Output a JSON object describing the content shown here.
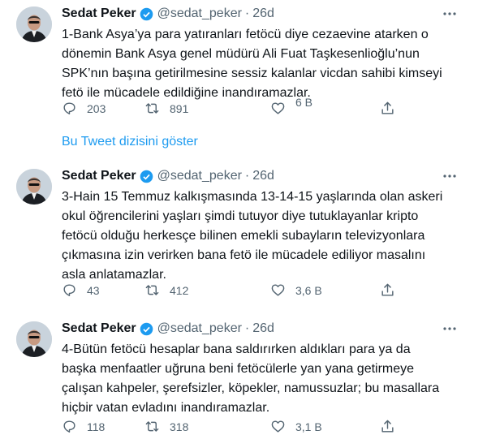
{
  "tweets": [
    {
      "name": "Sedat Peker",
      "handle": "@sedat_peker",
      "dot": "·",
      "time": "26d",
      "text": "1-Bank Asya’ya para yatıranları fetöcü diye cezaevine atarken o\ndönemin Bank Asya genel müdürü Ali Fuat Taşkesenlioğlu’nun\nSPK’nın başına getirilmesine sessiz kalanlar vicdan sahibi kimseyi\nfetö ile mücadele edildiğine inandıramazlar.",
      "replies": "203",
      "retweets": "891",
      "likes": "6 B"
    },
    {
      "name": "Sedat Peker",
      "handle": "@sedat_peker",
      "dot": "·",
      "time": "26d",
      "text": "3-Hain 15 Temmuz kalkışmasında 13-14-15 yaşlarında olan askeri\nokul öğrencilerini yaşları şimdi tutuyor diye tutuklayanlar kripto\nfetöcü olduğu herkesçe bilinen emekli subayların televizyonlara\nçıkmasına izin verirken bana fetö ile mücadele ediliyor masalını\nasla anlatamazlar.",
      "replies": "43",
      "retweets": "412",
      "likes": "3,6 B"
    },
    {
      "name": "Sedat Peker",
      "handle": "@sedat_peker",
      "dot": "·",
      "time": "26d",
      "text": "4-Bütün fetöcü hesaplar bana saldırırken aldıkları para ya da\nbaşka menfaatler uğruna beni fetöcülerle yan yana getirmeye\nçalışan kahpeler, şerefsizler, köpekler, namussuzlar; bu masallara\nhiçbir vatan evladını inandıramazlar.",
      "replies": "118",
      "retweets": "318",
      "likes": "3,1 B"
    }
  ],
  "thread_link": "Bu Tweet dizisini göster",
  "colors": {
    "accent": "#1d9bf0",
    "secondary_text": "#536471",
    "text": "#0f1419"
  },
  "icons": [
    "verified-icon",
    "more-icon",
    "reply-icon",
    "retweet-icon",
    "like-icon",
    "share-icon"
  ]
}
